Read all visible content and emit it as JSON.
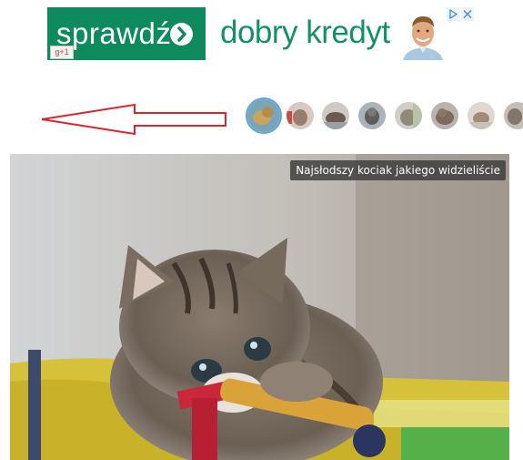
{
  "ad": {
    "left_text": "sprawdź",
    "right_text": "dobry kredyt",
    "gplus_label": "g+1",
    "colors": {
      "green": "#0f8a5f",
      "text_green": "#149164"
    }
  },
  "arrow": {
    "color": "#d9262c",
    "icon": "left-arrow-outline"
  },
  "thumbnails": [
    {
      "name": "thumb-1",
      "active": true
    },
    {
      "name": "thumb-2",
      "active": false
    },
    {
      "name": "thumb-3",
      "active": false
    },
    {
      "name": "thumb-4",
      "active": false
    },
    {
      "name": "thumb-5",
      "active": false
    },
    {
      "name": "thumb-6",
      "active": false
    },
    {
      "name": "thumb-7",
      "active": false
    },
    {
      "name": "thumb-8",
      "active": false
    }
  ],
  "main_image": {
    "caption": "Najsłodszy kociak jakiego widzieliście",
    "subject": "kitten"
  }
}
